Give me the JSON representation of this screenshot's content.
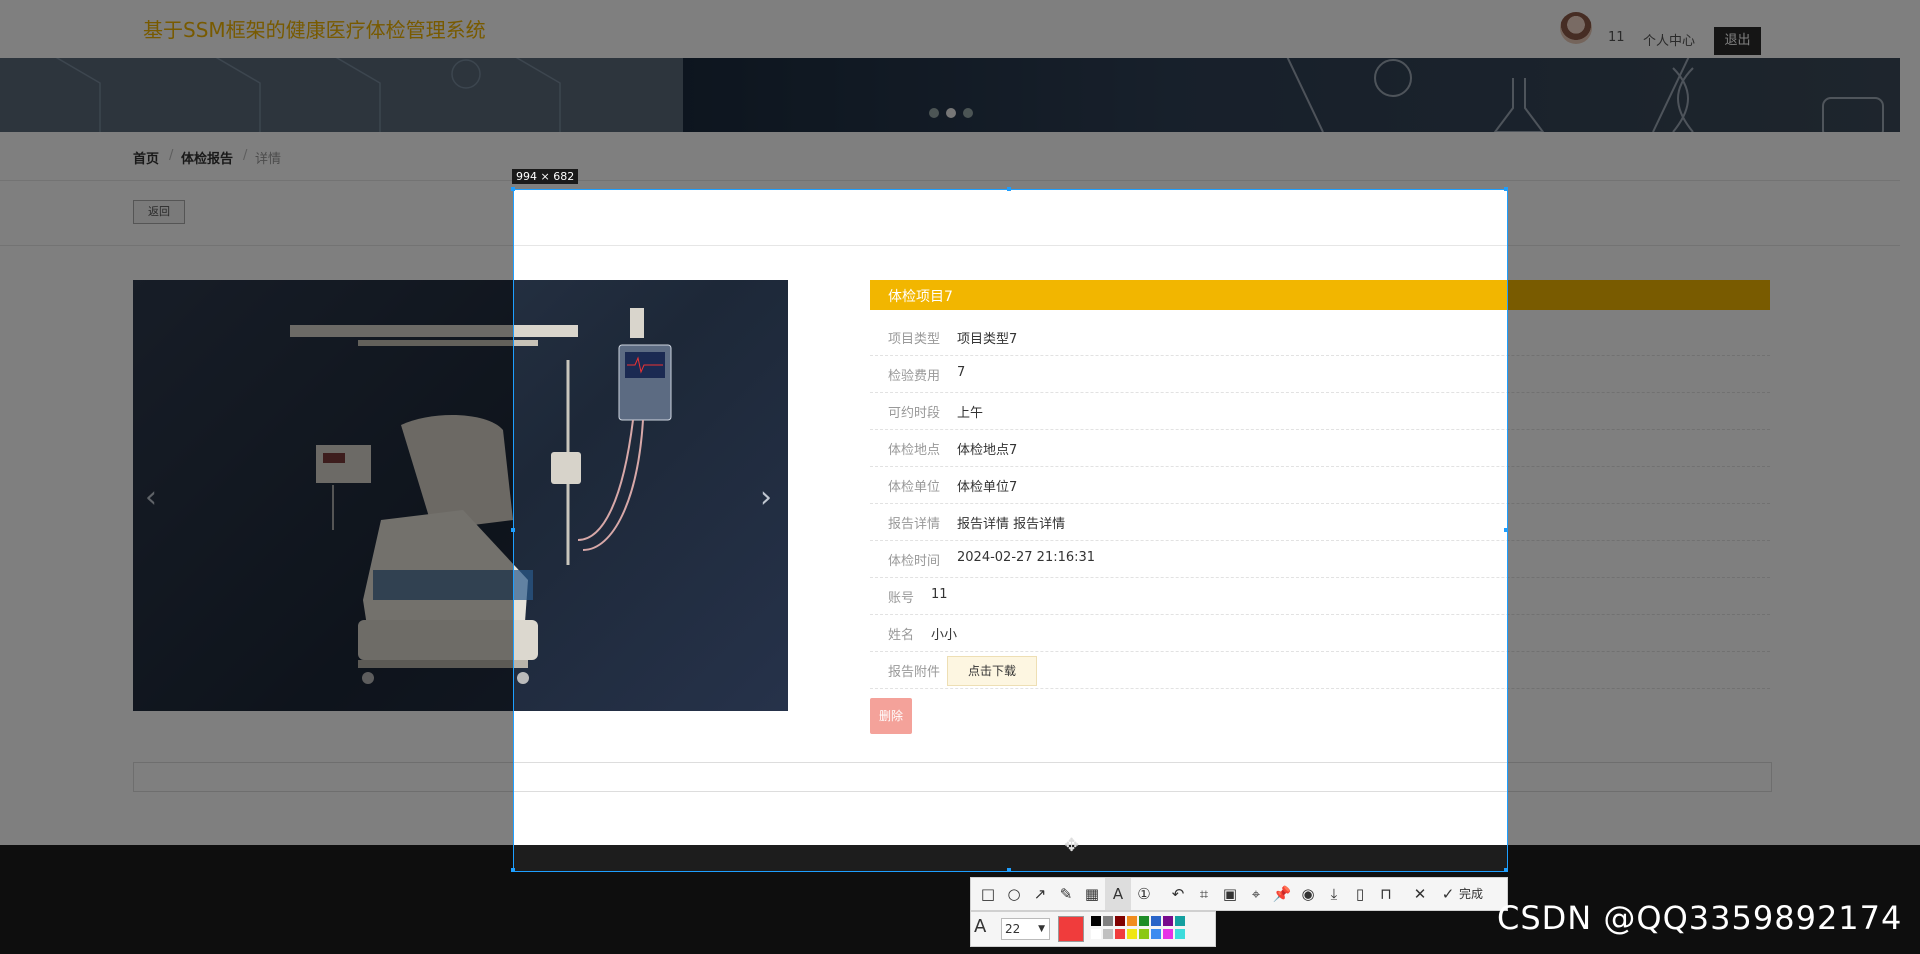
{
  "header": {
    "site_title": "基于SSM框架的健康医疗体检管理系统",
    "username": "11",
    "profile_link": "个人中心",
    "logout": "退出"
  },
  "breadcrumb": {
    "home": "首页",
    "section": "体检报告",
    "current": "详情",
    "separator": "/"
  },
  "back_button": "返回",
  "detail": {
    "title": "体检项目7",
    "rows": [
      {
        "label": "项目类型",
        "value": "项目类型7"
      },
      {
        "label": "检验费用",
        "value": "7"
      },
      {
        "label": "可约时段",
        "value": "上午"
      },
      {
        "label": "体检地点",
        "value": "体检地点7"
      },
      {
        "label": "体检单位",
        "value": "体检单位7"
      },
      {
        "label": "报告详情",
        "value": "报告详情 报告详情"
      },
      {
        "label": "体检时间",
        "value": "2024-02-27 21:16:31"
      },
      {
        "label": "账号",
        "value": "11"
      },
      {
        "label": "姓名",
        "value": "小小"
      },
      {
        "label": "报告附件",
        "value": ""
      }
    ],
    "download_button": "点击下载",
    "delete_button": "删除"
  },
  "carousel": {
    "prev_icon": "chevron-left-icon",
    "next_icon": "chevron-right-icon"
  },
  "capture_tool": {
    "size_label": "994 × 682",
    "done_label": "完成",
    "font_size": "22",
    "current_color": "#f03c3c",
    "palette": [
      "#000000",
      "#808080",
      "#800000",
      "#f08c1e",
      "#1e8c28",
      "#2864c8",
      "#780a8c",
      "#14a0a0",
      "#ffffff",
      "#c0c0c0",
      "#f03c3c",
      "#f0e614",
      "#8cc814",
      "#3c8cf0",
      "#e632e6",
      "#3cdcdc"
    ]
  },
  "watermark": "CSDN @QQ3359892174",
  "colors": {
    "accent": "#f2b600",
    "selection": "#1e9fff"
  }
}
